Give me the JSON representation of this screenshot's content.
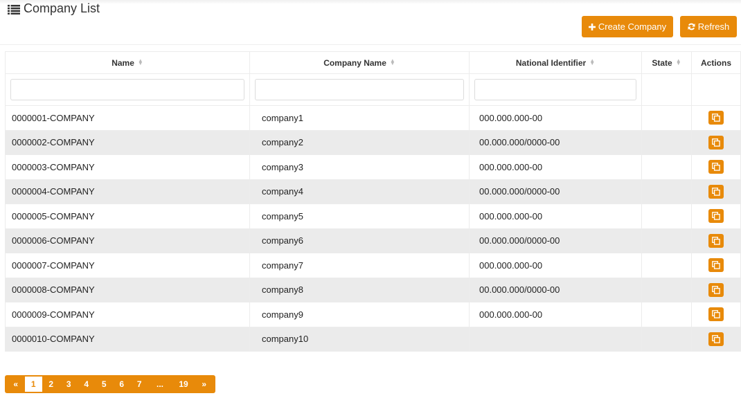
{
  "header": {
    "title": "Company List",
    "title_icon": "list-icon",
    "buttons": {
      "create_label": "Create Company",
      "create_icon": "plus-icon",
      "refresh_label": "Refresh",
      "refresh_icon": "refresh-icon"
    }
  },
  "theme": {
    "accent": "#e88a0a",
    "row_alt": "#ebebeb",
    "border": "#ececec"
  },
  "table": {
    "columns": [
      {
        "label": "Name",
        "sortable": true,
        "filter": true
      },
      {
        "label": "Company Name",
        "sortable": true,
        "filter": true
      },
      {
        "label": "National Identifier",
        "sortable": true,
        "filter": true
      },
      {
        "label": "State",
        "sortable": true,
        "filter": false
      },
      {
        "label": "Actions",
        "sortable": false,
        "filter": false
      }
    ],
    "filters": {
      "name": "",
      "company_name": "",
      "national_identifier": ""
    },
    "rows": [
      {
        "name": "0000001-COMPANY",
        "company_name": "company1",
        "national_identifier": "000.000.000-00",
        "state": ""
      },
      {
        "name": "0000002-COMPANY",
        "company_name": "company2",
        "national_identifier": "00.000.000/0000-00",
        "state": ""
      },
      {
        "name": "0000003-COMPANY",
        "company_name": "company3",
        "national_identifier": "000.000.000-00",
        "state": ""
      },
      {
        "name": "0000004-COMPANY",
        "company_name": "company4",
        "national_identifier": "00.000.000/0000-00",
        "state": ""
      },
      {
        "name": "0000005-COMPANY",
        "company_name": "company5",
        "national_identifier": "000.000.000-00",
        "state": ""
      },
      {
        "name": "0000006-COMPANY",
        "company_name": "company6",
        "national_identifier": "00.000.000/0000-00",
        "state": ""
      },
      {
        "name": "0000007-COMPANY",
        "company_name": "company7",
        "national_identifier": "000.000.000-00",
        "state": ""
      },
      {
        "name": "0000008-COMPANY",
        "company_name": "company8",
        "national_identifier": "00.000.000/0000-00",
        "state": ""
      },
      {
        "name": "0000009-COMPANY",
        "company_name": "company9",
        "national_identifier": "000.000.000-00",
        "state": ""
      },
      {
        "name": "0000010-COMPANY",
        "company_name": "company10",
        "national_identifier": "",
        "state": ""
      }
    ],
    "row_action_icon": "copy-icon"
  },
  "pagination": {
    "prev": "«",
    "pages": [
      "1",
      "2",
      "3",
      "4",
      "5",
      "6",
      "7",
      "...",
      "19"
    ],
    "next": "»",
    "current": "1"
  }
}
